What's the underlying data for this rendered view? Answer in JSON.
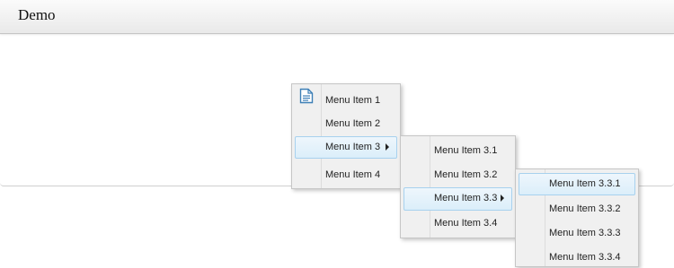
{
  "header": {
    "title": "Demo"
  },
  "menus": {
    "main": {
      "items": [
        {
          "label": "Menu Item 1",
          "icon": "document-icon"
        },
        {
          "label": "Menu Item 2"
        },
        {
          "label": "Menu Item 3",
          "has_submenu": true,
          "state": "highlighted"
        },
        {
          "label": "Menu Item 4"
        }
      ]
    },
    "sub3": {
      "items": [
        {
          "label": "Menu Item 3.1"
        },
        {
          "label": "Menu Item 3.2"
        },
        {
          "label": "Menu Item 3.3",
          "has_submenu": true,
          "state": "highlighted"
        },
        {
          "label": "Menu Item 3.4"
        }
      ]
    },
    "sub33": {
      "items": [
        {
          "label": "Menu Item 3.3.1",
          "state": "highlighted"
        },
        {
          "label": "Menu Item 3.3.2"
        },
        {
          "label": "Menu Item 3.3.3"
        },
        {
          "label": "Menu Item 3.3.4"
        }
      ]
    }
  },
  "colors": {
    "highlight_border": "#a7d1ee",
    "highlight_fill": "#dbeefa",
    "icon_blue": "#3d7fb6"
  }
}
